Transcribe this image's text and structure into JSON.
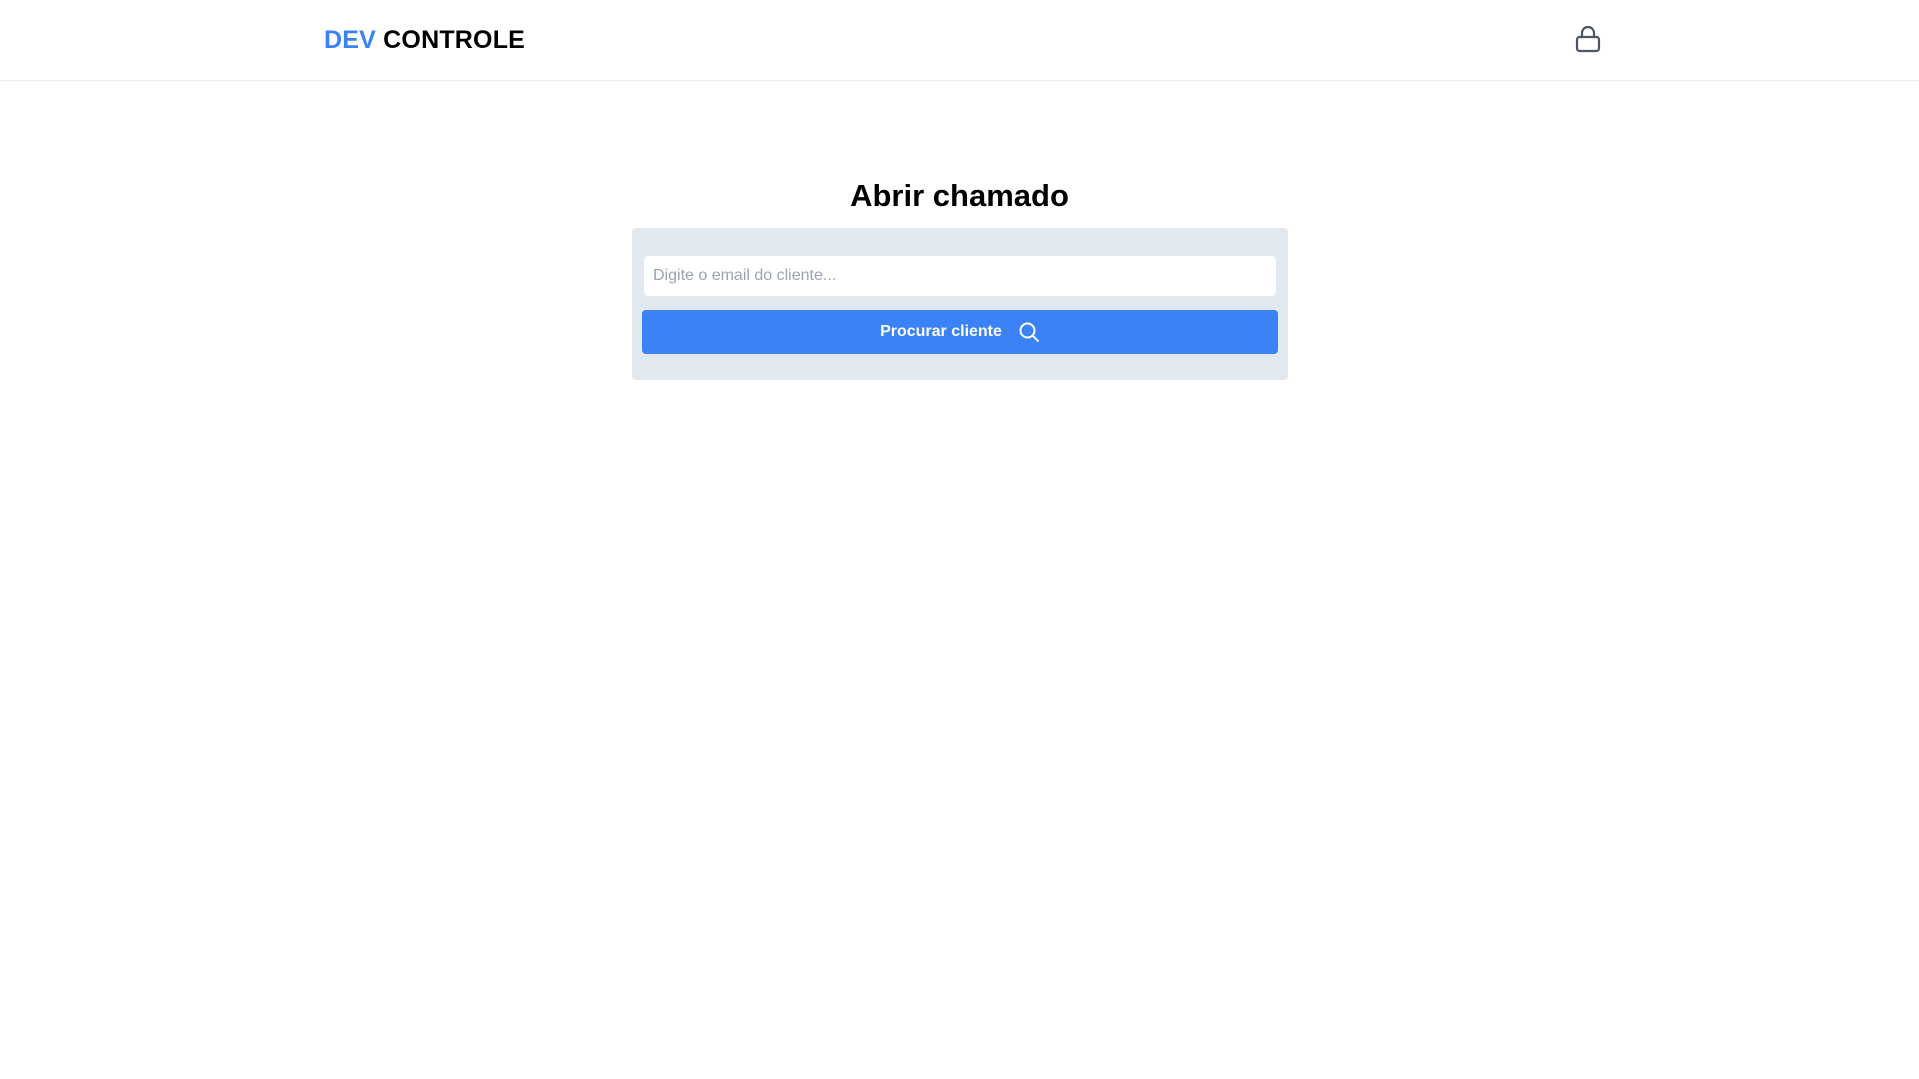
{
  "header": {
    "logo_part_1": "DEV",
    "logo_part_2": "CONTROLE",
    "logout_icon": "lock-icon"
  },
  "main": {
    "title": "Abrir chamado",
    "email_input": {
      "placeholder": "Digite o email do cliente...",
      "value": ""
    },
    "search_button": {
      "label": "Procurar cliente",
      "icon": "search-icon"
    }
  },
  "colors": {
    "accent": "#3b82f6",
    "card_background": "#e2e8f0",
    "icon": "#4b5563"
  }
}
